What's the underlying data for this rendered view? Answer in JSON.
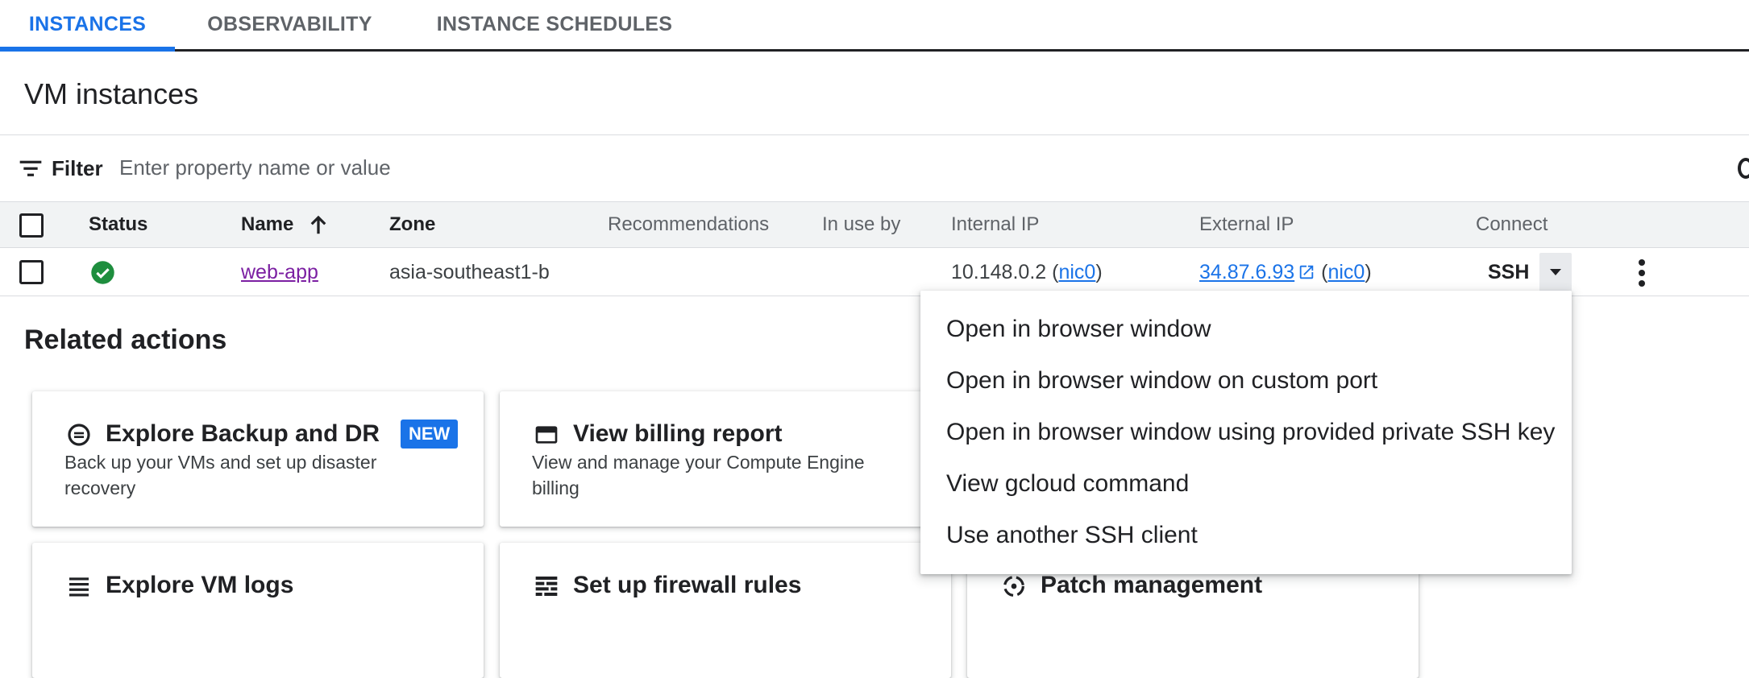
{
  "tabs": [
    {
      "label": "INSTANCES",
      "active": true
    },
    {
      "label": "OBSERVABILITY",
      "active": false
    },
    {
      "label": "INSTANCE SCHEDULES",
      "active": false
    }
  ],
  "page_title": "VM instances",
  "filter": {
    "label": "Filter",
    "placeholder": "Enter property name or value",
    "icon": "filter-list-icon"
  },
  "table": {
    "columns": {
      "status": "Status",
      "name": "Name",
      "zone": "Zone",
      "recommendations": "Recommendations",
      "in_use_by": "In use by",
      "internal_ip": "Internal IP",
      "external_ip": "External IP",
      "connect": "Connect"
    },
    "sort": {
      "column": "Name",
      "direction": "ascending",
      "icon": "arrow-upward-icon"
    },
    "rows": [
      {
        "status": "running",
        "status_icon": "check-circle-icon",
        "name": "web-app",
        "zone": "asia-southeast1-b",
        "recommendations": "",
        "in_use_by": "",
        "internal_ip": "10.148.0.2",
        "internal_nic": "nic0",
        "external_ip": "34.87.6.93",
        "external_nic": "nic0",
        "connect": "SSH"
      }
    ]
  },
  "related_actions": {
    "title": "Related actions",
    "cards": [
      {
        "title": "Explore Backup and DR",
        "badge": "NEW",
        "description": "Back up your VMs and set up disaster recovery",
        "icon": "backup-icon"
      },
      {
        "title": "View billing report",
        "description": "View and manage your Compute Engine billing",
        "icon": "credit-card-icon"
      },
      {
        "title": "Explore VM logs",
        "icon": "logs-list-icon"
      },
      {
        "title": "Set up firewall rules",
        "icon": "firewall-icon"
      },
      {
        "title": "Patch management",
        "icon": "patch-icon"
      }
    ]
  },
  "ssh_menu": {
    "items": [
      "Open in browser window",
      "Open in browser window on custom port",
      "Open in browser window using provided private SSH key",
      "View gcloud command",
      "Use another SSH client"
    ]
  },
  "colors": {
    "accent": "#1a73e8",
    "status_ok": "#1e8e3e",
    "visited_link": "#7b1fa2"
  }
}
